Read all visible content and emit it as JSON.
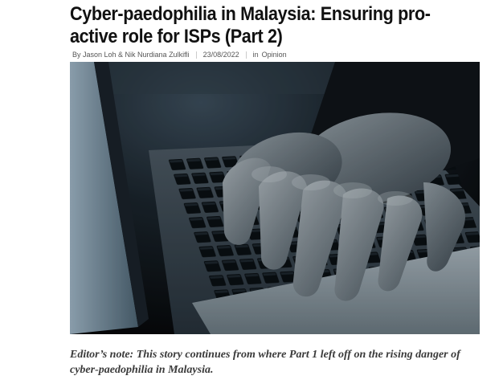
{
  "article": {
    "title": "Cyber-paedophilia in Malaysia: Ensuring pro-active role for ISPs (Part 2)",
    "byline": "By Jason Loh & Nik Nurdiana Zulkifli",
    "date": "23/08/2022",
    "category_prefix": "in",
    "category": "Opinion",
    "editor_note": "Editor’s note: This story continues from where Part 1 left off on the rising danger of cyber-paedophilia in Malaysia."
  }
}
